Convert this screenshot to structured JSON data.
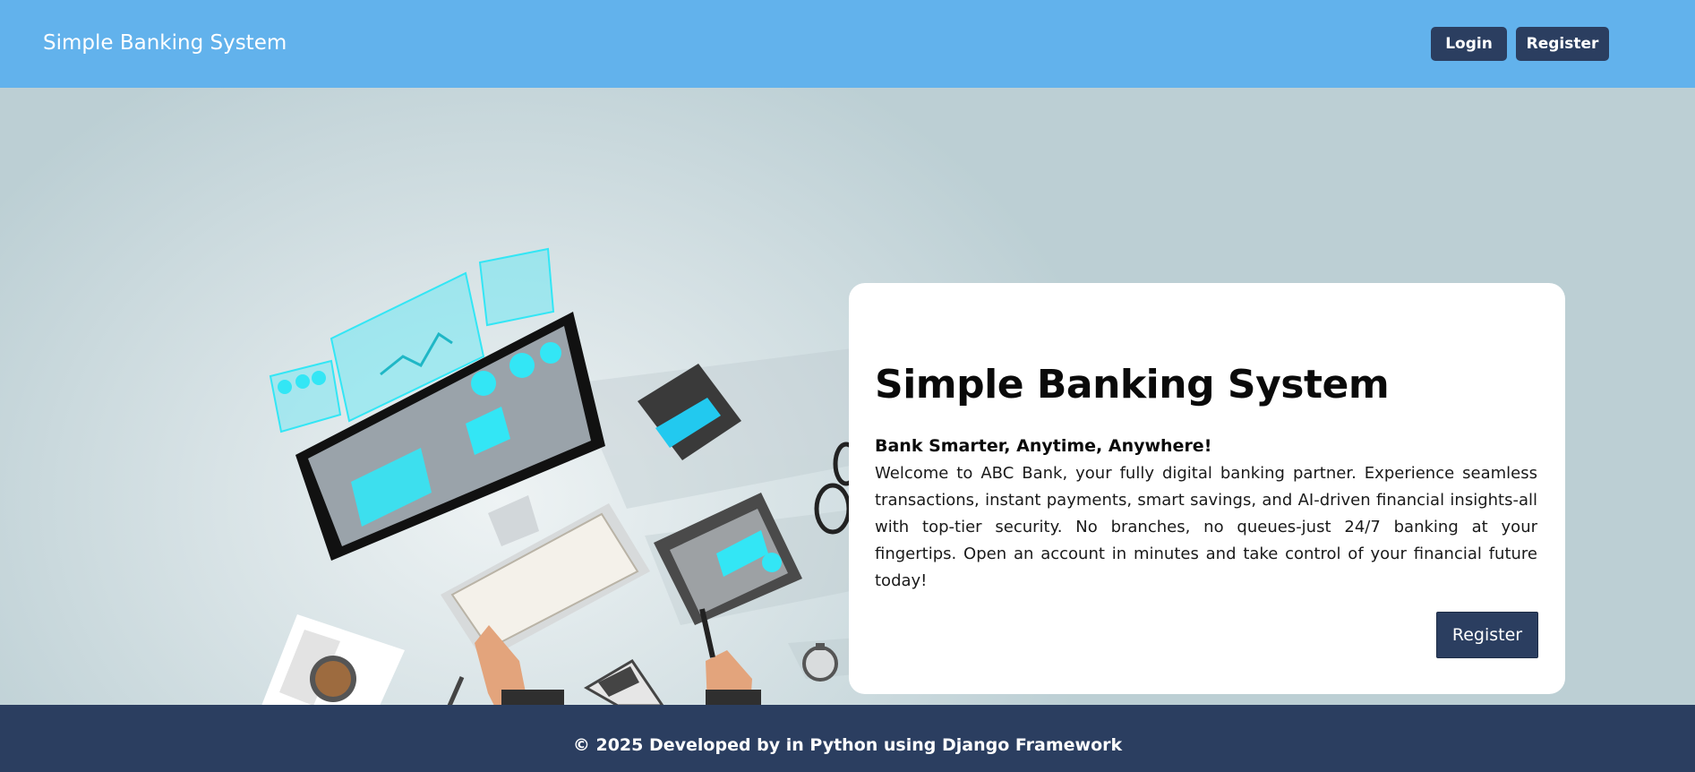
{
  "navbar": {
    "brand": "Simple Banking System",
    "login_label": "Login",
    "register_label": "Register"
  },
  "hero": {
    "title": "Simple Banking System",
    "tagline": "Bank Smarter, Anytime, Anywhere!",
    "description": "Welcome to ABC Bank, your fully digital banking partner. Experience seamless transactions, instant payments, smart savings, and AI-driven financial insights-all with top-tier security. No branches, no queues-just 24/7 banking at your fingertips. Open an account in minutes and take control of your financial future today!",
    "cta_label": "Register"
  },
  "footer": {
    "text": "© 2025 Developed by in Python using Django Framework"
  },
  "colors": {
    "navbar": "#62b2ec",
    "button": "#2b3e60",
    "footer": "#2b3e60",
    "accent_cyan": "#33e6f5"
  }
}
